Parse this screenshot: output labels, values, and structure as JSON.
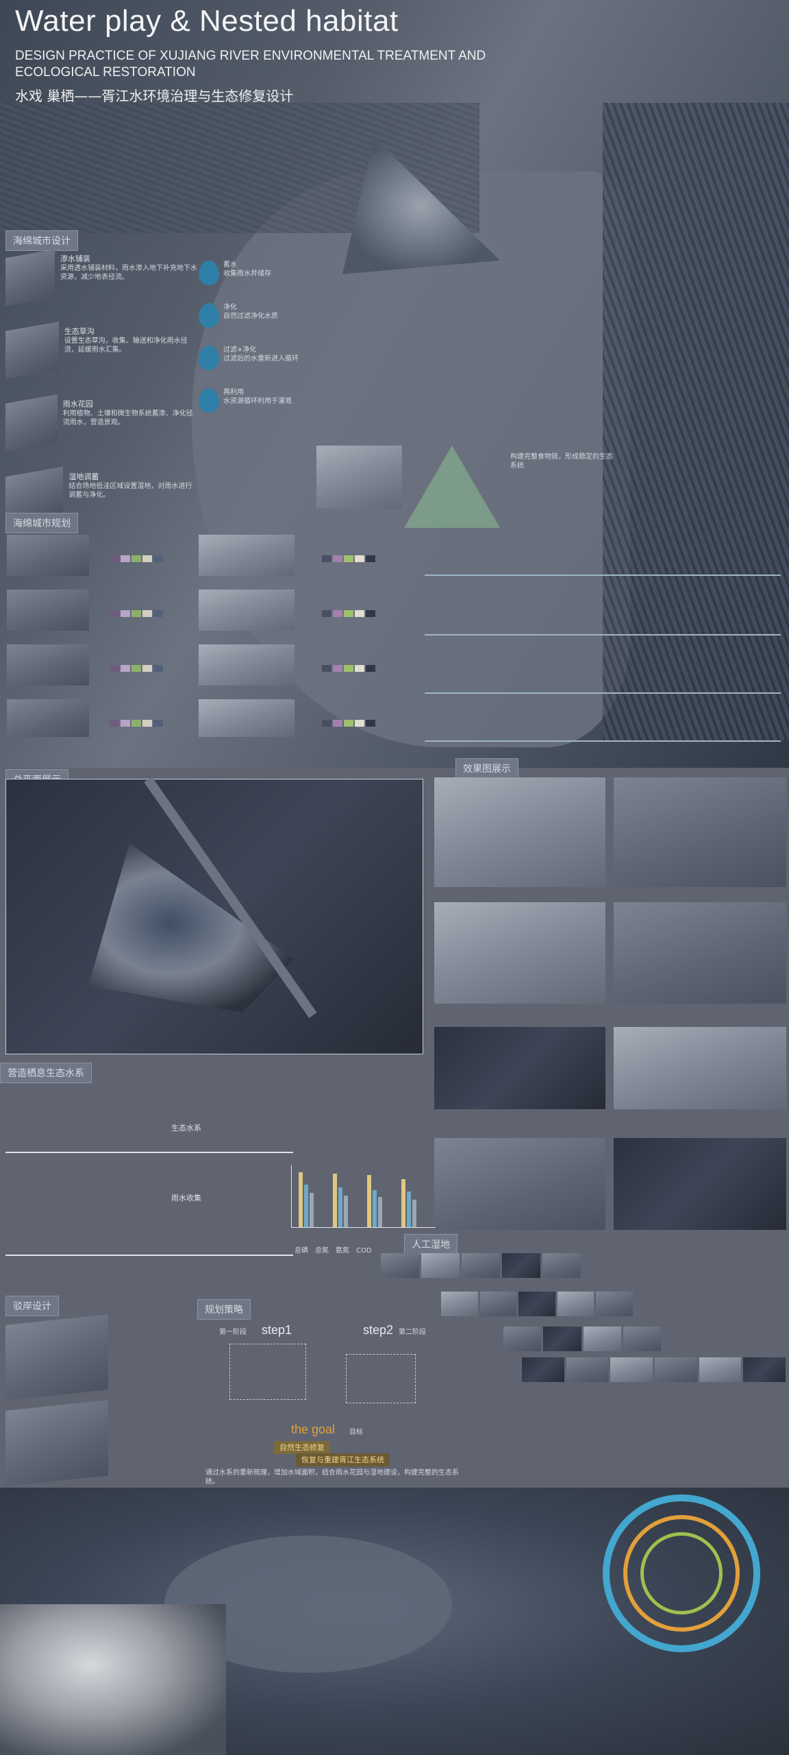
{
  "header": {
    "title": "Water play & Nested habitat",
    "subtitle_line1": "DESIGN PRACTICE OF  XUJIANG RIVER ENVIRONMENTAL TREATMENT AND",
    "subtitle_line2": "ECOLOGICAL RESTORATION",
    "cn_title": "水戏 巢栖——胥江水环境治理与生态修复设计"
  },
  "sections": {
    "sponge": "海绵城市设计",
    "sponge_plan": "海绵城市规划",
    "master_plan": "总平面展示",
    "effects": "效果图展示",
    "habitat": "营造栖息生态水系",
    "art_wetland": "人工湿地",
    "sink": "驳岸设计",
    "strategy": "规划策略"
  },
  "sponge_items": [
    {
      "label": "渗水铺装",
      "text": "采用透水铺装材料，雨水渗入地下补充地下水资源，减少地表径流。"
    },
    {
      "label": "生态草沟",
      "text": "设置生态草沟，收集、输送和净化雨水径流，延缓雨水汇集。"
    },
    {
      "label": "雨水花园",
      "text": "利用植物、土壤和微生物系统蓄渗、净化径流雨水，营造景观。"
    },
    {
      "label": "湿地调蓄",
      "text": "结合场地低洼区域设置湿地，对雨水进行调蓄与净化。"
    }
  ],
  "water_cycle": [
    {
      "label": "蓄水",
      "text": "收集雨水并储存"
    },
    {
      "label": "净化",
      "text": "自然过滤净化水质"
    },
    {
      "label": "过滤+净化",
      "text": "过滤后的水重新进入循环"
    },
    {
      "label": "再利用",
      "text": "水资源循环利用于灌溉"
    }
  ],
  "pyramid_text": "构建完整食物链，形成稳定的生态系统",
  "habitat_texts": {
    "note_a": "生态水系",
    "note_b": "雨水收集"
  },
  "strategy": {
    "step1": "step1",
    "step2": "step2",
    "goal": "the goal",
    "goal_cn": "目标",
    "step1_cn": "第一阶段",
    "step2_cn": "第二阶段",
    "goal_banner": "自然生态修复",
    "goal_banner2": "恢复与重建胥江生态系统",
    "goal_text": "通过水系的重新梳理，增加水域面积，结合雨水花园与湿地建设，构建完整的生态系统。"
  },
  "chart": {
    "legend": [
      "总磷",
      "总氮",
      "氨氮",
      "COD"
    ]
  },
  "colors": {
    "bg": "#5f6470",
    "accent": "#3f8fb0",
    "ring_orange": "#e2a03a",
    "ring_green": "#9ec24e",
    "ring_blue": "#43a7cf"
  }
}
